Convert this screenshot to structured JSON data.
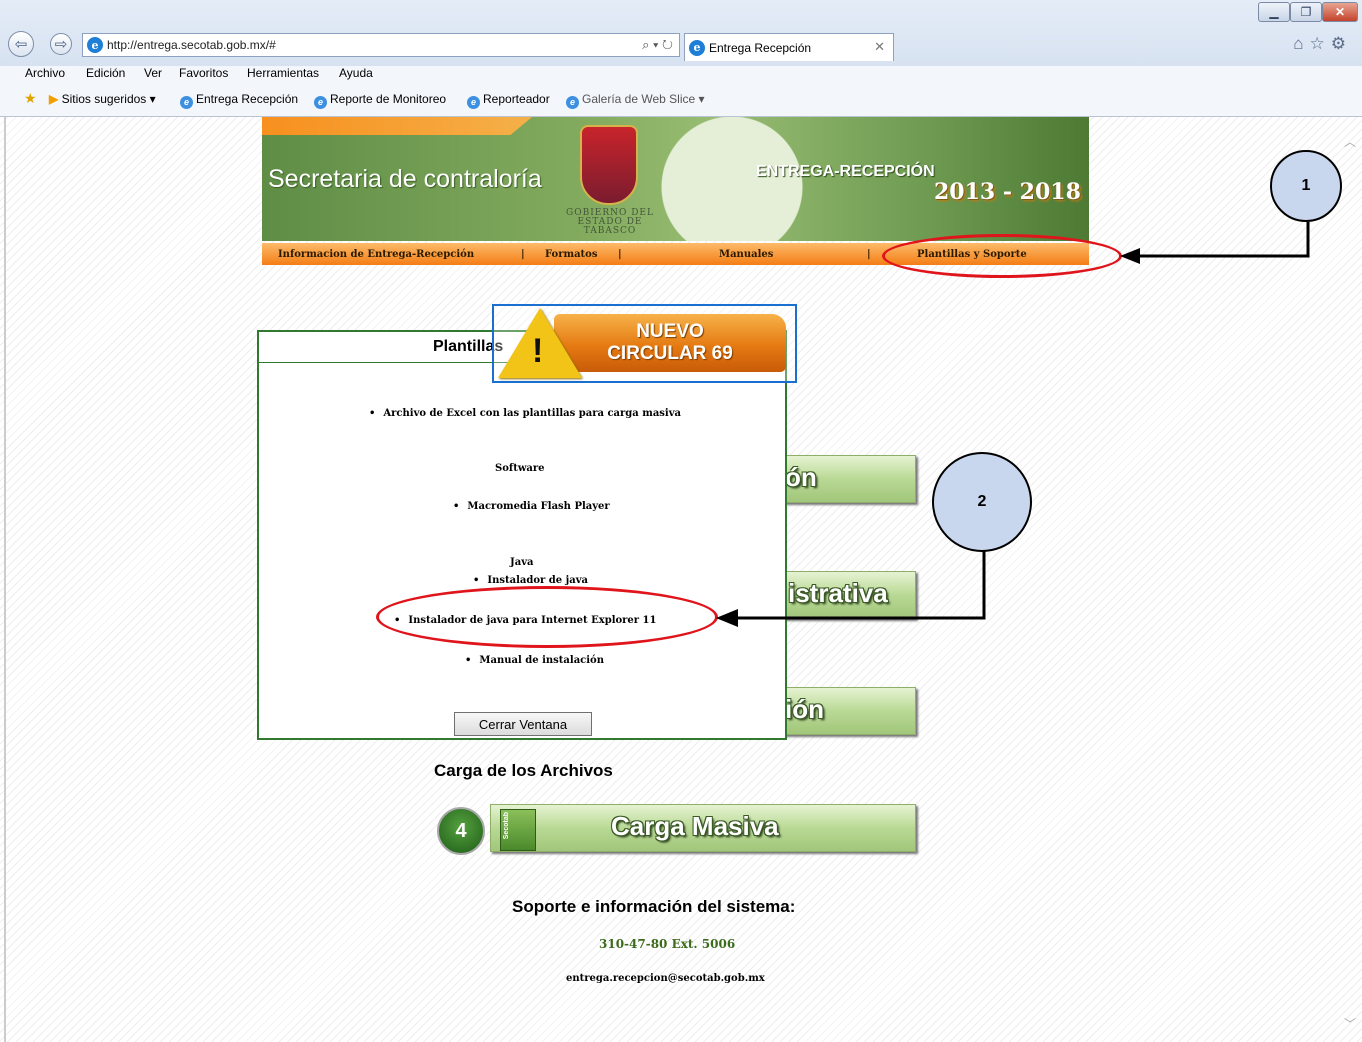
{
  "browser": {
    "address": "http://entrega.secotab.gob.mx/#",
    "tab_title": "Entrega Recepción",
    "menu": [
      "Archivo",
      "Edición",
      "Ver",
      "Favoritos",
      "Herramientas",
      "Ayuda"
    ],
    "favorites": [
      "Sitios sugeridos ▾",
      "Entrega Recepción",
      "Reporte de Monitoreo",
      "Reporteador",
      "Galería de Web Slice ▾"
    ]
  },
  "banner": {
    "title": "Secretaria de contraloría",
    "seal_text": "GOBIERNO DEL ESTADO DE TABASCO",
    "program": "ENTREGA-RECEPCIÓN",
    "years": "2013 - 2018",
    "nav": [
      "Informacion de Entrega-Recepción",
      "|",
      "Formatos",
      "|",
      "Manuales",
      "|",
      "Plantillas y Soporte"
    ]
  },
  "callouts": {
    "one": "1",
    "two": "2"
  },
  "notice": {
    "line1": "NUEVO",
    "line2": "CIRCULAR 69"
  },
  "popup": {
    "title": "Plantillas",
    "excel": "Archivo de Excel con las plantillas para carga masiva",
    "software_heading": "Software",
    "flash": "Macromedia Flash Player",
    "java_heading": "Java",
    "java_installer": "Instalador de java",
    "java_ie11": "Instalador de java para Internet Explorer 11",
    "manual": "Manual de instalación",
    "close": "Cerrar Ventana"
  },
  "buttons": {
    "btn1_tail": "ón",
    "btn2_tail": "istrativa",
    "btn3_tail": "ión",
    "carga_masiva": "Carga Masiva",
    "carga_number": "4",
    "logo_text": "Secotab"
  },
  "carga_heading": "Carga de los Archivos",
  "soporte": {
    "heading": "Soporte e información del sistema:",
    "phone": "310-47-80 Ext. 5006",
    "email": "entrega.recepcion@secotab.gob.mx"
  },
  "colors": {
    "highlight": "#e0141b",
    "accent_green": "#2f7a2f",
    "orange": "#f47d16"
  }
}
